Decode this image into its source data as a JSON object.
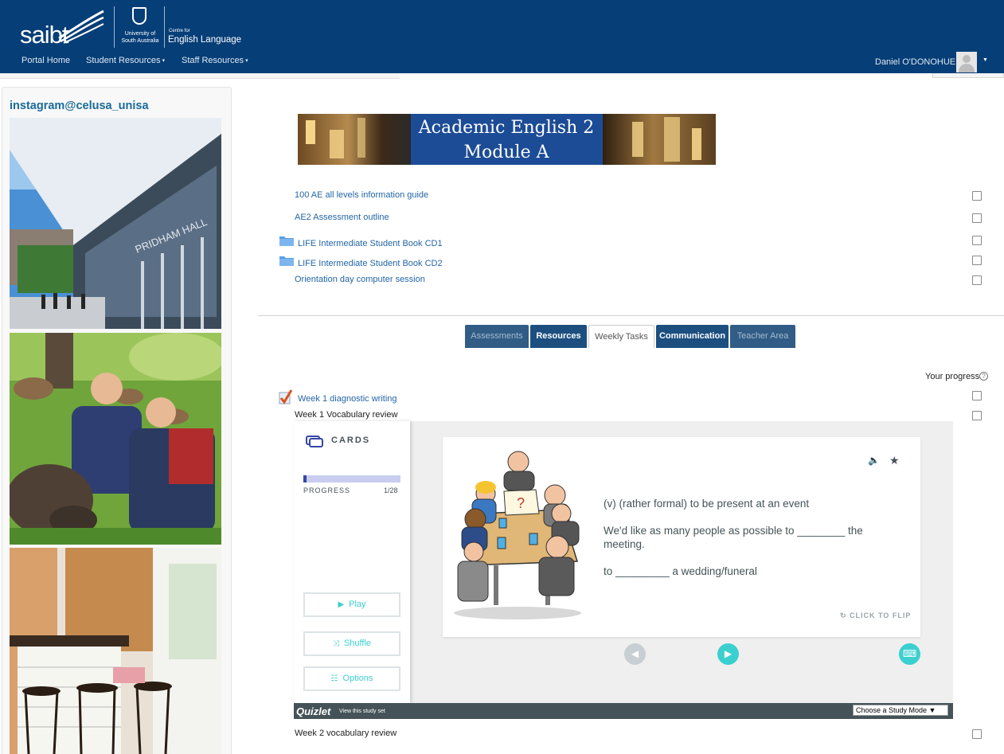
{
  "header": {
    "brand": "saibt",
    "unisa": [
      "University of",
      "South Australia"
    ],
    "centre_small": "Centre for",
    "centre_big": "English Language",
    "nav": [
      "Portal Home",
      "Student Resources",
      "Staff Resources"
    ],
    "user_name": "Daniel O'DONOHUE",
    "caret": "▾",
    "user_caret": "▼"
  },
  "sidebar": {
    "title": "instagram@celusa_unisa",
    "photo1_sign": "PRIDHAM HALL"
  },
  "banner": {
    "line1": "Academic English 2",
    "line2": "Module A"
  },
  "resources": [
    "100 AE all levels information guide",
    "AE2 Assessment outline",
    "LIFE Intermediate Student Book CD1",
    "LIFE Intermediate Student Book CD2",
    "Orientation day computer session"
  ],
  "tabs": [
    "Assessments",
    "Resources",
    "Weekly Tasks",
    "Communication",
    "Teacher Area"
  ],
  "progress_label": "Your progress",
  "help_glyph": "?",
  "weekly": {
    "item1": "Week 1 diagnostic writing",
    "item2": "Week 1 Vocabulary review",
    "item3": "Week 2 vocabulary review"
  },
  "quizlet": {
    "mode_label": "CARDS",
    "progress_label": "PROGRESS",
    "progress_count": "1/28",
    "progress_fraction": 0.036,
    "buttons": {
      "play": "Play",
      "shuffle": "Shuffle",
      "options": "Options"
    },
    "glyphs": {
      "play": "▶",
      "shuffle": "⤨",
      "options": "☷",
      "speaker": "🔈",
      "star": "★",
      "prev": "◀",
      "next": "▶",
      "keyboard": "⌨",
      "flip": "↻"
    },
    "card": {
      "definition": "(v) (rather formal) to be present at an event",
      "example1": "We'd like as many people as possible to ________ the meeting.",
      "example2": "to _________ a wedding/funeral",
      "flip_label": "CLICK TO FLIP"
    },
    "footer": {
      "logo": "Quizlet",
      "view": "View this study set",
      "select": "Choose a Study Mode ▼"
    },
    "colors": {
      "accent": "#3ccfcf",
      "dark": "#455358",
      "progress": "#3646a4"
    }
  }
}
